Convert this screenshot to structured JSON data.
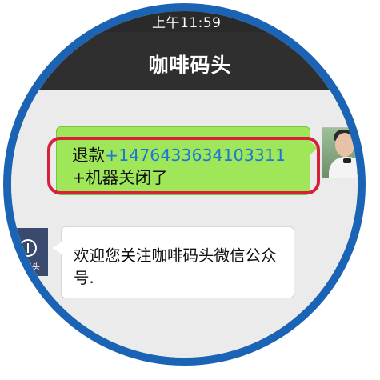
{
  "status_bar": {
    "time": "上午11:59"
  },
  "nav": {
    "title": "咖啡码头"
  },
  "messages": {
    "sent": {
      "prefix": "退款",
      "link_number": "+1476433634103311",
      "suffix": "+机器关闭了"
    },
    "received": {
      "text": "欢迎您关注咖啡码头微信公众号."
    }
  },
  "avatars": {
    "bot_label": "码头"
  },
  "colors": {
    "frame_border": "#1a63b5",
    "sent_bubble": "#9fe658",
    "highlight": "#d9203b",
    "link": "#1a78d8",
    "navbar": "#2f2f2f"
  },
  "icons": [
    "back-chevron-icon",
    "anchor-icon"
  ]
}
